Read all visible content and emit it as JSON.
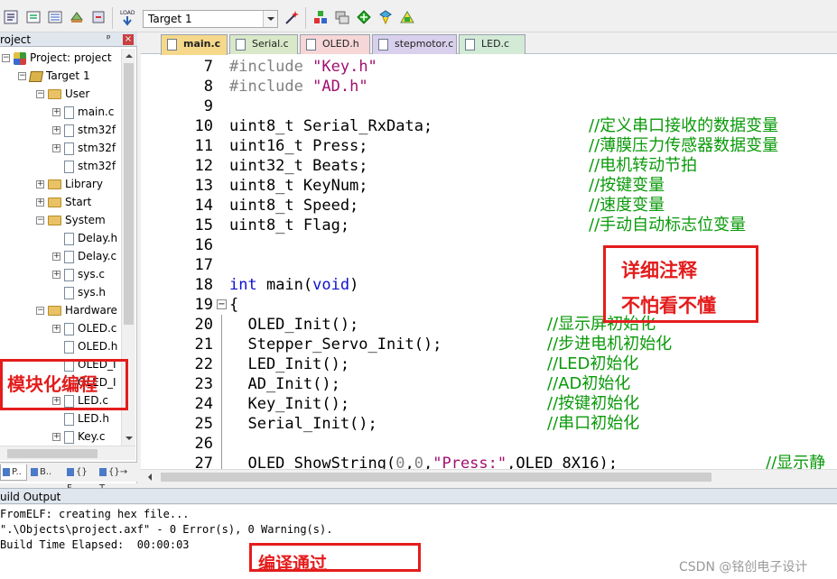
{
  "toolbar": {
    "target": "Target 1",
    "icons": [
      "options-icon",
      "translate-icon",
      "build-icon",
      "rebuild-icon",
      "load-icon",
      "manage-components-icon",
      "select-packs-icon",
      "pack-installer-icon",
      "magic-wand-icon",
      "event-icon"
    ]
  },
  "project_panel": {
    "title": "roject",
    "pin": "ᵖ",
    "close": "×",
    "tree": [
      {
        "label": "Project: project",
        "kind": "project",
        "level": 0,
        "expander": "−"
      },
      {
        "label": "Target 1",
        "kind": "target",
        "level": 1,
        "expander": "−"
      },
      {
        "label": "User",
        "kind": "folder",
        "level": 2,
        "expander": "−"
      },
      {
        "label": "main.c",
        "kind": "file",
        "level": 3,
        "expander": "+"
      },
      {
        "label": "stm32f",
        "kind": "file",
        "level": 3,
        "expander": "+"
      },
      {
        "label": "stm32f",
        "kind": "file",
        "level": 3,
        "expander": "+"
      },
      {
        "label": "stm32f",
        "kind": "file",
        "level": 3,
        "expander": ""
      },
      {
        "label": "Library",
        "kind": "folder",
        "level": 2,
        "expander": "+"
      },
      {
        "label": "Start",
        "kind": "folder",
        "level": 2,
        "expander": "+"
      },
      {
        "label": "System",
        "kind": "folder",
        "level": 2,
        "expander": "−"
      },
      {
        "label": "Delay.h",
        "kind": "file",
        "level": 3,
        "expander": ""
      },
      {
        "label": "Delay.c",
        "kind": "file",
        "level": 3,
        "expander": "+"
      },
      {
        "label": "sys.c",
        "kind": "file",
        "level": 3,
        "expander": "+"
      },
      {
        "label": "sys.h",
        "kind": "file",
        "level": 3,
        "expander": ""
      },
      {
        "label": "Hardware",
        "kind": "folder",
        "level": 2,
        "expander": "−"
      },
      {
        "label": "OLED.c",
        "kind": "file",
        "level": 3,
        "expander": "+"
      },
      {
        "label": "OLED.h",
        "kind": "file",
        "level": 3,
        "expander": ""
      },
      {
        "label": "OLED_I",
        "kind": "file",
        "level": 3,
        "expander": ""
      },
      {
        "label": "OLED_I",
        "kind": "file",
        "level": 3,
        "expander": ""
      },
      {
        "label": "LED.c",
        "kind": "file",
        "level": 3,
        "expander": "+"
      },
      {
        "label": "LED.h",
        "kind": "file",
        "level": 3,
        "expander": ""
      },
      {
        "label": "Key.c",
        "kind": "file",
        "level": 3,
        "expander": "+"
      }
    ],
    "tabs": [
      {
        "label": "P..",
        "icon": "project-tab-icon"
      },
      {
        "label": "B..",
        "icon": "books-tab-icon"
      },
      {
        "label": "{} F..",
        "icon": "functions-tab-icon"
      },
      {
        "label": "{}→ T..",
        "icon": "templates-tab-icon"
      }
    ]
  },
  "file_tabs": [
    {
      "label": "main.c",
      "color": "#f5d88a",
      "active": true
    },
    {
      "label": "Serial.c",
      "color": "#d8e8c8",
      "active": false
    },
    {
      "label": "OLED.h",
      "color": "#f6d6d6",
      "active": false
    },
    {
      "label": "stepmotor.c",
      "color": "#d8d0ec",
      "active": false
    },
    {
      "label": "LED.c",
      "color": "#d2ead6",
      "active": false
    }
  ],
  "code_lines": [
    {
      "num": "7",
      "code": "#include \"Key.h\"",
      "comment": ""
    },
    {
      "num": "8",
      "code": "#include \"AD.h\"",
      "comment": ""
    },
    {
      "num": "9",
      "code": "",
      "comment": ""
    },
    {
      "num": "10",
      "code": "uint8_t Serial_RxData;",
      "comment": "//定义串口接收的数据变量"
    },
    {
      "num": "11",
      "code": "uint16_t Press;",
      "comment": "//薄膜压力传感器数据变量"
    },
    {
      "num": "12",
      "code": "uint32_t Beats;",
      "comment": "//电机转动节拍"
    },
    {
      "num": "13",
      "code": "uint8_t KeyNum;",
      "comment": "//按键变量"
    },
    {
      "num": "14",
      "code": "uint8_t Speed;",
      "comment": "//速度变量"
    },
    {
      "num": "15",
      "code": "uint8_t Flag;",
      "comment": "//手动自动标志位变量"
    },
    {
      "num": "16",
      "code": "",
      "comment": ""
    },
    {
      "num": "17",
      "code": "",
      "comment": ""
    },
    {
      "num": "18",
      "code": "int main(void)",
      "comment": ""
    },
    {
      "num": "19",
      "code": "{",
      "comment": ""
    },
    {
      "num": "20",
      "code": "  OLED_Init();",
      "comment": "//显示屏初始化"
    },
    {
      "num": "21",
      "code": "  Stepper_Servo_Init();",
      "comment": "//步进电机初始化"
    },
    {
      "num": "22",
      "code": "  LED_Init();",
      "comment": "//LED初始化"
    },
    {
      "num": "23",
      "code": "  AD_Init();",
      "comment": "//AD初始化"
    },
    {
      "num": "24",
      "code": "  Key_Init();",
      "comment": "//按键初始化"
    },
    {
      "num": "25",
      "code": "  Serial_Init();",
      "comment": "//串口初始化"
    },
    {
      "num": "26",
      "code": "",
      "comment": ""
    },
    {
      "num": "27",
      "code": "  OLED_ShowString(0,0,\"Press:\",OLED_8X16);",
      "comment": "//显示静"
    }
  ],
  "build_output": {
    "title": "uild Output",
    "lines": [
      "FromELF: creating hex file...",
      "\".\\Objects\\project.axf\" - 0 Error(s), 0 Warning(s).",
      "Build Time Elapsed:  00:00:03"
    ]
  },
  "annotations": {
    "detail_comments_1": "详细注释",
    "detail_comments_2": "不怕看不懂",
    "modular": "模块化编程",
    "compile_pass": "编译通过"
  },
  "watermark": "CSDN @铭创电子设计",
  "colors": {
    "annotation_red": "#e41c1c",
    "comment_green": "#0a9a0a",
    "keyword_blue": "#1010d0",
    "string_magenta": "#a01070",
    "preprocessor_gray": "#808080"
  }
}
